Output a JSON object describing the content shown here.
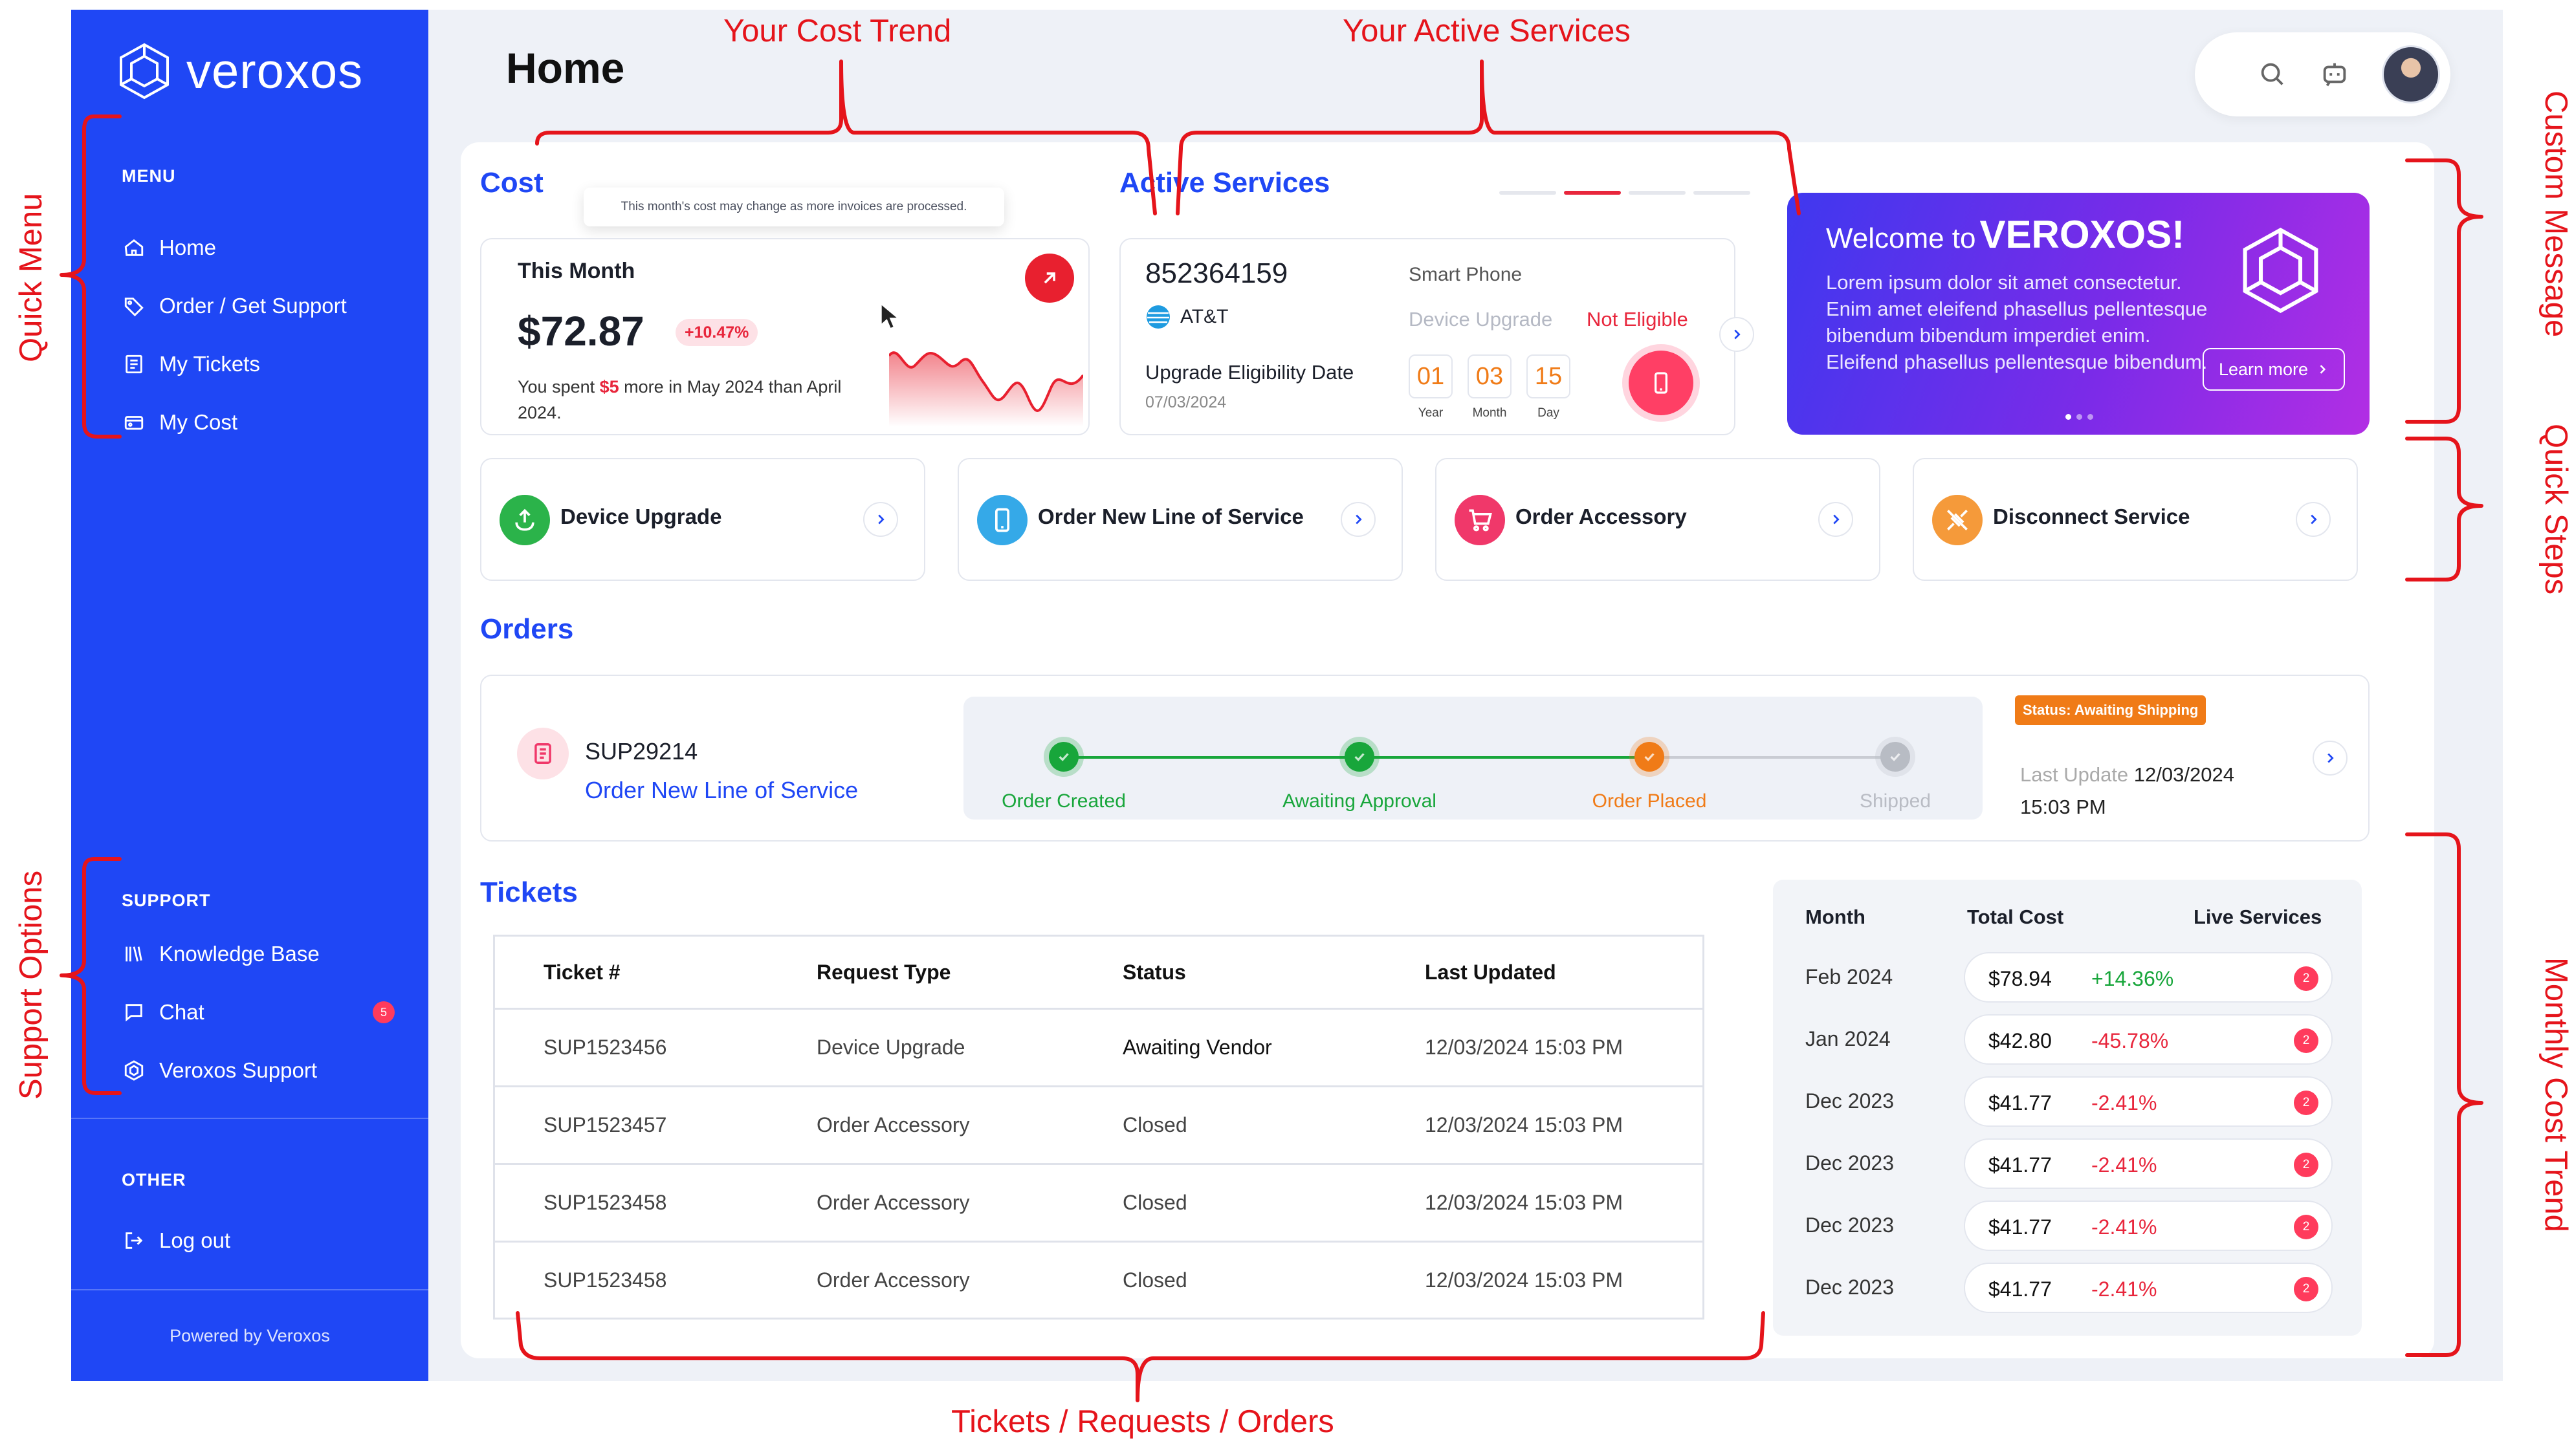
{
  "brand": {
    "name": "veroxos"
  },
  "sidebar": {
    "menu_title": "MENU",
    "menu_items": [
      {
        "label": "Home",
        "icon": "home-icon"
      },
      {
        "label": "Order / Get Support",
        "icon": "tag-icon"
      },
      {
        "label": "My Tickets",
        "icon": "tickets-icon"
      },
      {
        "label": "My Cost",
        "icon": "wallet-icon"
      }
    ],
    "support_title": "SUPPORT",
    "support_items": [
      {
        "label": "Knowledge Base",
        "icon": "book-icon"
      },
      {
        "label": "Chat",
        "icon": "chat-icon",
        "badge": "5"
      },
      {
        "label": "Veroxos Support",
        "icon": "hex-icon"
      }
    ],
    "other_title": "OTHER",
    "other_items": [
      {
        "label": "Log out",
        "icon": "logout-icon"
      }
    ],
    "powered_by": "Powered by Veroxos"
  },
  "header": {
    "title": "Home"
  },
  "cost": {
    "heading": "Cost",
    "tooltip": "This month's cost may change as more invoices are processed.",
    "month_label": "This Month",
    "value": "$72.87",
    "change": "+10.47%",
    "note_prefix": "You spent ",
    "note_highlight": "$5",
    "note_suffix": " more in May 2024 than April 2024.",
    "accent": "#e8202f"
  },
  "active_services": {
    "heading": "Active Services",
    "number": "852364159",
    "type": "Smart Phone",
    "carrier": "AT&T",
    "device_upgrade_label": "Device Upgrade",
    "device_upgrade_status": "Not Eligible",
    "eligibility_label": "Upgrade Eligibility Date",
    "eligibility_date": "07/03/2024",
    "countdown": [
      {
        "value": "01",
        "caption": "Year"
      },
      {
        "value": "03",
        "caption": "Month"
      },
      {
        "value": "15",
        "caption": "Day"
      }
    ]
  },
  "welcome": {
    "prefix": "Welcome to",
    "brand": "VEROXOS!",
    "body": "Lorem ipsum dolor sit amet consectetur. Enim amet eleifend phasellus pellentesque bibendum bibendum imperdiet enim. Eleifend phasellus pellentesque bibendum.",
    "button": "Learn more"
  },
  "quick_steps": [
    {
      "label": "Device Upgrade",
      "icon": "upgrade-icon",
      "color": "#2bb34a"
    },
    {
      "label": "Order New Line of Service",
      "icon": "phone-icon",
      "color": "#35a9e8"
    },
    {
      "label": "Order Accessory",
      "icon": "cart-icon",
      "color": "#f0386a"
    },
    {
      "label": "Disconnect Service",
      "icon": "disconnect-icon",
      "color": "#f59a3a"
    }
  ],
  "orders": {
    "heading": "Orders",
    "id": "SUP29214",
    "type": "Order New Line of Service",
    "steps": [
      {
        "label": "Order Created",
        "color": "#18a63b"
      },
      {
        "label": "Awaiting Approval",
        "color": "#18a63b"
      },
      {
        "label": "Order Placed",
        "color": "#f07b17"
      },
      {
        "label": "Shipped",
        "color": "#b9bcc4"
      }
    ],
    "status_tag": "Status: Awaiting Shipping",
    "last_update_label": "Last Update",
    "last_update_date": "12/03/2024",
    "last_update_time": "15:03 PM"
  },
  "tickets": {
    "heading": "Tickets",
    "columns": [
      "Ticket #",
      "Request Type",
      "Status",
      "Last Updated"
    ],
    "rows": [
      [
        "SUP1523456",
        "Device Upgrade",
        "Awaiting Vendor",
        "12/03/2024 15:03 PM"
      ],
      [
        "SUP1523457",
        "Order Accessory",
        "Closed",
        "12/03/2024 15:03 PM"
      ],
      [
        "SUP1523458",
        "Order Accessory",
        "Closed",
        "12/03/2024 15:03 PM"
      ],
      [
        "SUP1523458",
        "Order Accessory",
        "Closed",
        "12/03/2024 15:03 PM"
      ]
    ]
  },
  "monthly_cost": {
    "columns": [
      "Month",
      "Total Cost",
      "Live Services"
    ],
    "rows": [
      {
        "month": "Feb 2024",
        "cost": "$78.94",
        "change": "+14.36%",
        "dir": "up",
        "services": "2"
      },
      {
        "month": "Jan 2024",
        "cost": "$42.80",
        "change": "-45.78%",
        "dir": "down",
        "services": "2"
      },
      {
        "month": "Dec 2023",
        "cost": "$41.77",
        "change": "-2.41%",
        "dir": "down",
        "services": "2"
      },
      {
        "month": "Dec 2023",
        "cost": "$41.77",
        "change": "-2.41%",
        "dir": "down",
        "services": "2"
      },
      {
        "month": "Dec 2023",
        "cost": "$41.77",
        "change": "-2.41%",
        "dir": "down",
        "services": "2"
      },
      {
        "month": "Dec 2023",
        "cost": "$41.77",
        "change": "-2.41%",
        "dir": "down",
        "services": "2"
      }
    ]
  },
  "annotations": {
    "cost_trend": "Your Cost Trend",
    "active_services": "Your Active Services",
    "quick_menu": "Quick Menu",
    "support_options": "Support Options",
    "custom_message": "Custom Message",
    "quick_steps": "Quick Steps",
    "monthly_cost_trend": "Monthly Cost Trend",
    "tickets": "Tickets / Requests / Orders",
    "color": "#e5141b"
  }
}
